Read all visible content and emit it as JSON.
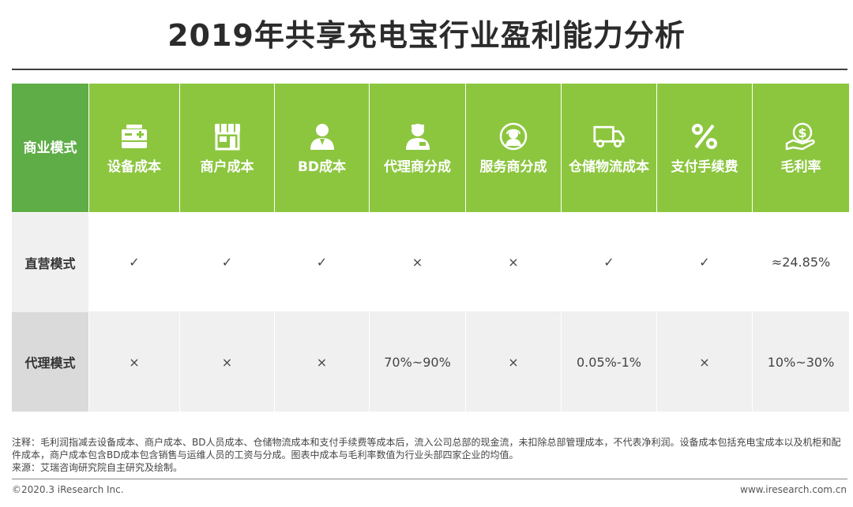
{
  "title": "2019年共享充电宝行业盈利能力分析",
  "table": {
    "corner": "商业模式",
    "columns": [
      {
        "label": "设备成本",
        "icon": "charger-device-icon"
      },
      {
        "label": "商户成本",
        "icon": "storefront-icon"
      },
      {
        "label": "BD成本",
        "icon": "person-icon"
      },
      {
        "label": "代理商分成",
        "icon": "agent-person-icon"
      },
      {
        "label": "服务商分成",
        "icon": "service-headset-icon"
      },
      {
        "label": "仓储物流成本",
        "icon": "delivery-truck-icon"
      },
      {
        "label": "支付手续费",
        "icon": "percent-icon"
      },
      {
        "label": "毛利率",
        "icon": "money-hand-icon"
      }
    ],
    "rows": [
      {
        "label": "直营模式",
        "cells": [
          "✓",
          "✓",
          "✓",
          "×",
          "×",
          "✓",
          "✓",
          "≈24.85%"
        ]
      },
      {
        "label": "代理模式",
        "cells": [
          "×",
          "×",
          "×",
          "70%~90%",
          "×",
          "0.05%-1%",
          "×",
          "10%~30%"
        ]
      }
    ]
  },
  "note": "注释：毛利润指减去设备成本、商户成本、BD人员成本、仓储物流成本和支付手续费等成本后，流入公司总部的现金流，未扣除总部管理成本，不代表净利润。设备成本包括充电宝成本以及机柜和配件成本，商户成本包含BD成本包含销售与运维人员的工资与分成。图表中成本与毛利率数值为行业头部四家企业的均值。",
  "source": "来源：艾瑞咨询研究院自主研究及绘制。",
  "footer": {
    "left": "©2020.3 iResearch Inc.",
    "right": "www.iresearch.com.cn"
  },
  "colors": {
    "header_green": "#8cc63f",
    "corner_green": "#5fad47",
    "row_label_gray": "#f0f0f0"
  }
}
